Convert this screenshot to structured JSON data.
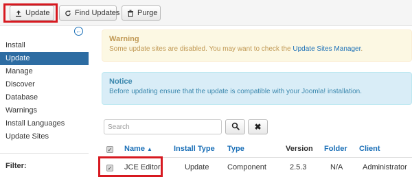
{
  "toolbar": {
    "update_label": "Update",
    "find_updates_label": "Find Updates",
    "purge_label": "Purge"
  },
  "sidebar": {
    "items": [
      {
        "label": "Install"
      },
      {
        "label": "Update",
        "active": true
      },
      {
        "label": "Manage"
      },
      {
        "label": "Discover"
      },
      {
        "label": "Database"
      },
      {
        "label": "Warnings"
      },
      {
        "label": "Install Languages"
      },
      {
        "label": "Update Sites"
      }
    ],
    "filter_label": "Filter:"
  },
  "alerts": {
    "warning": {
      "heading": "Warning",
      "text": "Some update sites are disabled. You may want to check the ",
      "link": "Update Sites Manager",
      "suffix": "."
    },
    "notice": {
      "heading": "Notice",
      "text": "Before updating ensure that the update is compatible with your Joomla! installation."
    }
  },
  "search": {
    "placeholder": "Search"
  },
  "table": {
    "columns": {
      "name": "Name",
      "install_type": "Install Type",
      "type": "Type",
      "version": "Version",
      "folder": "Folder",
      "client": "Client"
    },
    "rows": [
      {
        "name": "JCE Editor",
        "install_type": "Update",
        "type": "Component",
        "version": "2.5.3",
        "folder": "N/A",
        "client": "Administrator",
        "checked": true
      }
    ]
  },
  "colors": {
    "highlight": "#d71920",
    "link": "#1a6fb7",
    "active_nav": "#2d6ca2",
    "warning_bg": "#fcf8e3",
    "notice_bg": "#d9edf7"
  },
  "icons": [
    "upload-icon",
    "refresh-icon",
    "trash-icon",
    "collapse-arrow-icon",
    "search-icon",
    "clear-icon",
    "check-icon",
    "sort-ascending-icon"
  ]
}
